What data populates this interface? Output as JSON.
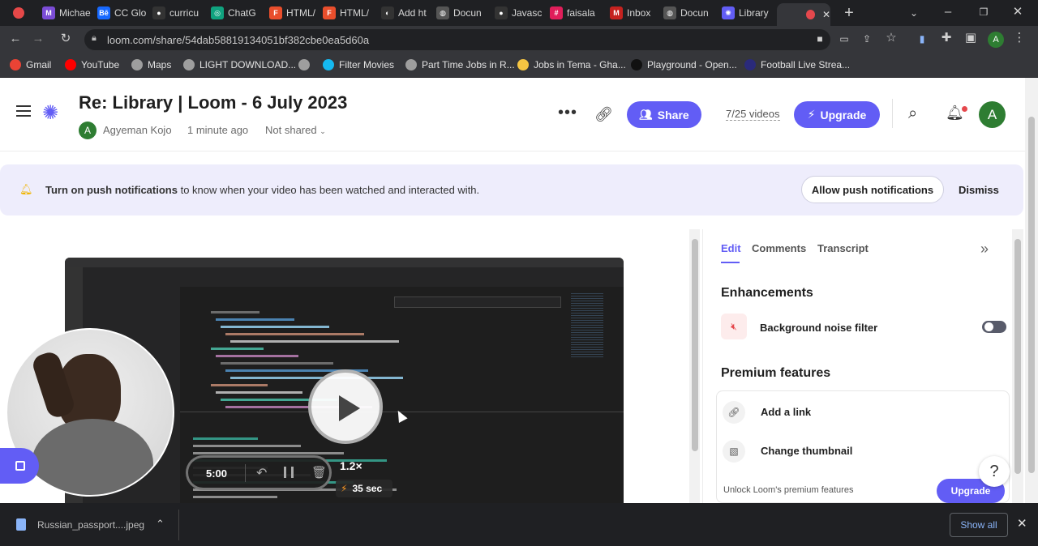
{
  "tabs": [
    {
      "label": "Michae",
      "color": "#7b4cd6",
      "glyph": "M"
    },
    {
      "label": "CC Glo",
      "color": "#1769ff",
      "glyph": "Bē"
    },
    {
      "label": "curricu",
      "color": "#333333",
      "glyph": "●"
    },
    {
      "label": "ChatG",
      "color": "#10a37f",
      "glyph": "◎"
    },
    {
      "label": "HTML/",
      "color": "#e94e2c",
      "glyph": "F"
    },
    {
      "label": "HTML/",
      "color": "#e94e2c",
      "glyph": "F"
    },
    {
      "label": "Add ht",
      "color": "#333333",
      "glyph": "◐"
    },
    {
      "label": "Docun",
      "color": "#555555",
      "glyph": "◍"
    },
    {
      "label": "Javasc",
      "color": "#333333",
      "glyph": "●"
    },
    {
      "label": "faisala",
      "color": "#e01e5a",
      "glyph": "#"
    },
    {
      "label": "Inbox",
      "color": "#c5221f",
      "glyph": "M"
    },
    {
      "label": "Docun",
      "color": "#555555",
      "glyph": "◍"
    },
    {
      "label": "Library",
      "color": "#625df5",
      "glyph": "✺"
    }
  ],
  "url": "loom.com/share/54dab58819134051bf382cbe0ea5d60a",
  "bookmarks": [
    {
      "label": "Gmail",
      "color": "#ea4335"
    },
    {
      "label": "YouTube",
      "color": "#ff0000"
    },
    {
      "label": "Maps",
      "color": "#9e9e9e"
    },
    {
      "label": "LIGHT DOWNLOAD...",
      "color": "#9e9e9e"
    },
    {
      "label": "",
      "color": "#9e9e9e"
    },
    {
      "label": "Filter Movies",
      "color": "#15b9f0"
    },
    {
      "label": "Part Time Jobs in R...",
      "color": "#9e9e9e"
    },
    {
      "label": "Jobs in Tema - Gha...",
      "color": "#f5c542"
    },
    {
      "label": "Playground - Open...",
      "color": "#111111"
    },
    {
      "label": "Football Live Strea...",
      "color": "#2a2a7a"
    }
  ],
  "header": {
    "title": "Re: Library | Loom - 6 July 2023",
    "author": "Agyeman Kojo",
    "avatar_letter": "A",
    "time_ago": "1 minute ago",
    "sharing": "Not shared",
    "share_label": "Share",
    "video_count": "7/25 videos",
    "upgrade_label": "Upgrade",
    "user_avatar": "A"
  },
  "banner": {
    "bold": "Turn on push notifications",
    "rest": " to know when your video has been watched and interacted with.",
    "allow_label": "Allow push notifications",
    "dismiss_label": "Dismiss"
  },
  "player": {
    "time": "5:00",
    "speed": "1.2×",
    "saved": "35 sec"
  },
  "sidebar": {
    "tabs": [
      "Edit",
      "Comments",
      "Transcript"
    ],
    "enhancements_title": "Enhancements",
    "noise_filter": "Background noise filter",
    "noise_enabled": false,
    "premium_title": "Premium features",
    "add_link": "Add a link",
    "change_thumbnail": "Change thumbnail",
    "unlock_text": "Unlock Loom's premium features",
    "upgrade_label": "Upgrade",
    "help": "?"
  },
  "download": {
    "file": "Russian_passport....jpeg",
    "show_all": "Show all"
  },
  "colors": {
    "brand": "#625df5",
    "banner": "#eeedfc",
    "avatar_green": "#2e7d32"
  }
}
